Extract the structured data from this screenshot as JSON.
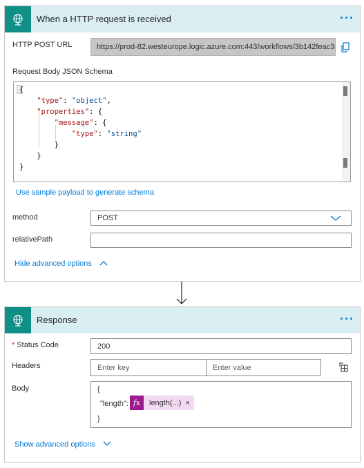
{
  "trigger": {
    "title": "When a HTTP request is received",
    "more": "···",
    "url_label": "HTTP POST URL",
    "url_value": "https://prod-82.westeurope.logic.azure.com:443/workflows/3b142feac3d...",
    "schema_label": "Request Body JSON Schema",
    "schema_lines": [
      "{",
      "    \"type\": \"object\",",
      "    \"properties\": {",
      "        \"message\": {",
      "            \"type\": \"string\"",
      "        }",
      "    }",
      "}"
    ],
    "sample_link": "Use sample payload to generate schema",
    "method_label": "method",
    "method_value": "POST",
    "relative_path_label": "relativePath",
    "relative_path_value": "",
    "toggle_advanced": "Hide advanced options"
  },
  "response": {
    "title": "Response",
    "more": "···",
    "status_label": "Status Code",
    "status_required": "*",
    "status_value": "200",
    "headers_label": "Headers",
    "key_placeholder": "Enter key",
    "value_placeholder": "Enter value",
    "body_label": "Body",
    "body_open": "{",
    "body_key": "\"length\":",
    "body_token_icon": "fx",
    "body_token_label": "length(...)",
    "body_token_remove": "×",
    "body_close": "}",
    "toggle_advanced": "Show advanced options"
  },
  "icons": {
    "trigger": "globe-icon",
    "response": "globe-icon",
    "copy": "copy-icon",
    "dropdown": "chevron-down-icon",
    "connector": "arrow-down-icon",
    "headers_mode": "switch-to-text-mode-icon"
  },
  "colors": {
    "header_bg": "#d9eef2",
    "icon_bg": "#0f8f86",
    "accent": "#0078d4",
    "token_fx": "#9b1a8f",
    "token_bg": "#f3d9f2"
  }
}
